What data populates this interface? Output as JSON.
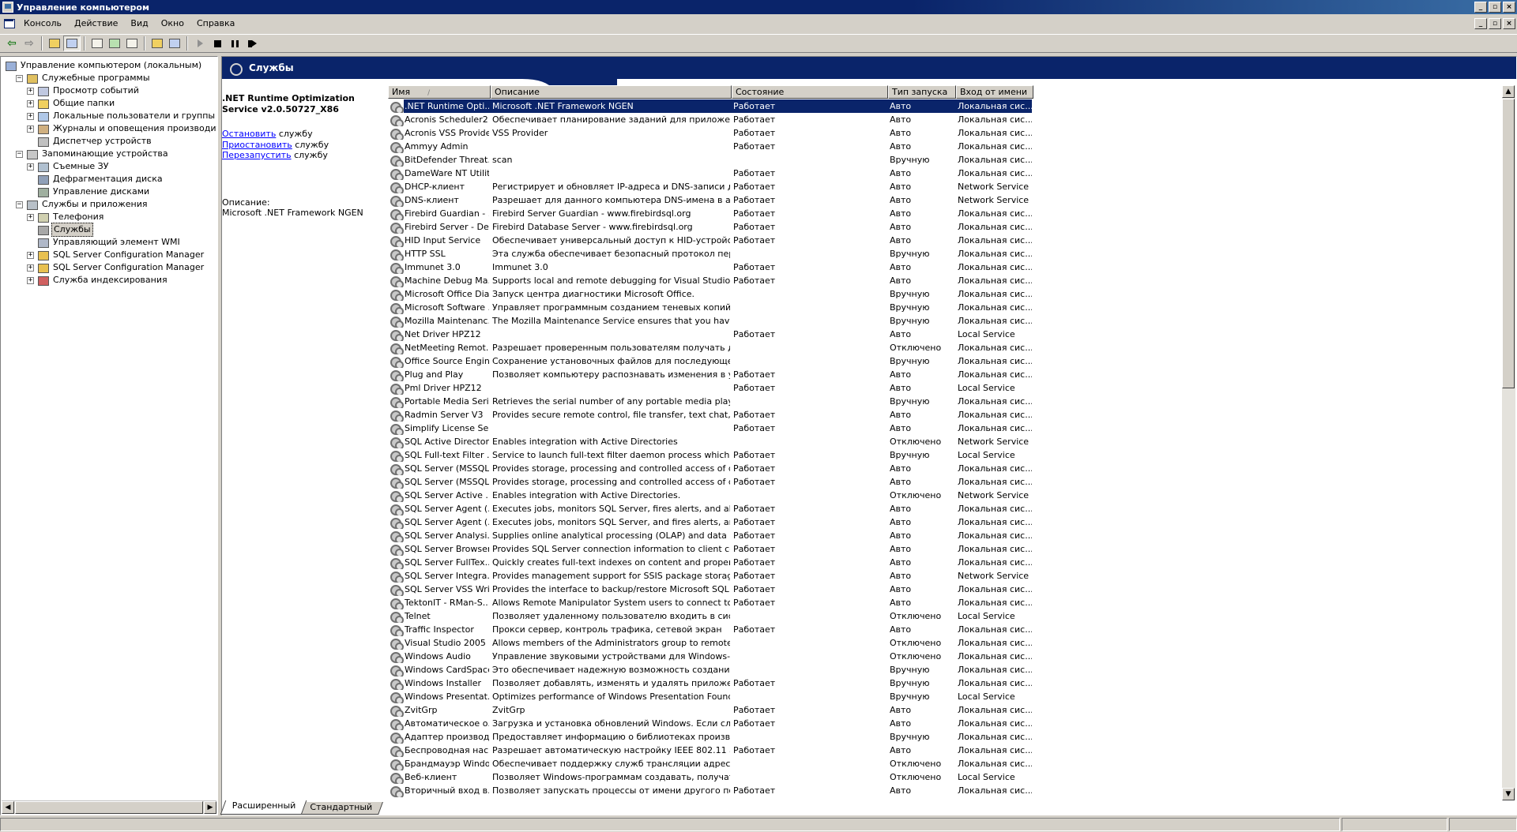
{
  "window": {
    "title": "Управление компьютером",
    "buttons": {
      "minimize": "_",
      "maximize": "▫",
      "close": "×"
    }
  },
  "menu": [
    "Консоль",
    "Действие",
    "Вид",
    "Окно",
    "Справка"
  ],
  "tree": {
    "nodes": [
      {
        "label": "Управление компьютером (локальным)",
        "level": 0,
        "expander": "",
        "color": "#9ab0d8"
      },
      {
        "label": "Служебные программы",
        "level": 1,
        "expander": "−",
        "color": "#e0c060"
      },
      {
        "label": "Просмотр событий",
        "level": 2,
        "expander": "+",
        "color": "#c0c8e0"
      },
      {
        "label": "Общие папки",
        "level": 2,
        "expander": "+",
        "color": "#f0d060"
      },
      {
        "label": "Локальные пользователи и группы",
        "level": 2,
        "expander": "+",
        "color": "#b0c8e8"
      },
      {
        "label": "Журналы и оповещения производительности",
        "level": 2,
        "expander": "+",
        "color": "#d0b080"
      },
      {
        "label": "Диспетчер устройств",
        "level": 2,
        "expander": "",
        "color": "#c0c0c0"
      },
      {
        "label": "Запоминающие устройства",
        "level": 1,
        "expander": "−",
        "color": "#c8c8c8"
      },
      {
        "label": "Съемные ЗУ",
        "level": 2,
        "expander": "+",
        "color": "#b0c0d0"
      },
      {
        "label": "Дефрагментация диска",
        "level": 2,
        "expander": "",
        "color": "#90a0b8"
      },
      {
        "label": "Управление дисками",
        "level": 2,
        "expander": "",
        "color": "#a0b0a0"
      },
      {
        "label": "Службы и приложения",
        "level": 1,
        "expander": "−",
        "color": "#b8c0c8"
      },
      {
        "label": "Телефония",
        "level": 2,
        "expander": "+",
        "color": "#d0d0b0"
      },
      {
        "label": "Службы",
        "level": 2,
        "expander": "",
        "color": "#a8a8a8",
        "selected": true
      },
      {
        "label": "Управляющий элемент WMI",
        "level": 2,
        "expander": "",
        "color": "#b0b8c8"
      },
      {
        "label": "SQL Server Configuration Manager",
        "level": 2,
        "expander": "+",
        "color": "#e8c050"
      },
      {
        "label": "SQL Server Configuration Manager",
        "level": 2,
        "expander": "+",
        "color": "#e8c050"
      },
      {
        "label": "Служба индексирования",
        "level": 2,
        "expander": "+",
        "color": "#d06060"
      }
    ]
  },
  "banner": {
    "title": "Службы"
  },
  "details": {
    "service_title": ".NET Runtime Optimization Service v2.0.50727_X86",
    "actions": [
      {
        "link": "Остановить",
        "suffix": "службу"
      },
      {
        "link": "Приостановить",
        "suffix": "службу"
      },
      {
        "link": "Перезапустить",
        "suffix": "службу"
      }
    ],
    "description_label": "Описание:",
    "description": "Microsoft .NET Framework NGEN"
  },
  "columns": {
    "name": "Имя",
    "sort_indicator": "/",
    "desc": "Описание",
    "status": "Состояние",
    "start": "Тип запуска",
    "logon": "Вход от имени"
  },
  "services": [
    {
      "name": ".NET Runtime Opti...",
      "desc": "Microsoft .NET Framework NGEN",
      "status": "Работает",
      "start": "Авто",
      "logon": "Локальная сис...",
      "selected": true
    },
    {
      "name": "Acronis Scheduler2 ...",
      "desc": "Обеспечивает планирование заданий для приложени...",
      "status": "Работает",
      "start": "Авто",
      "logon": "Локальная сис..."
    },
    {
      "name": "Acronis VSS Provider",
      "desc": "VSS Provider",
      "status": "Работает",
      "start": "Авто",
      "logon": "Локальная сис..."
    },
    {
      "name": "Ammyy Admin",
      "desc": "",
      "status": "Работает",
      "start": "Авто",
      "logon": "Локальная сис..."
    },
    {
      "name": "BitDefender Threat...",
      "desc": "scan",
      "status": "",
      "start": "Вручную",
      "logon": "Локальная сис..."
    },
    {
      "name": "DameWare NT Utilit...",
      "desc": "",
      "status": "Работает",
      "start": "Авто",
      "logon": "Локальная сис..."
    },
    {
      "name": "DHCP-клиент",
      "desc": "Регистрирует и обновляет IP-адреса и DNS-записи дл...",
      "status": "Работает",
      "start": "Авто",
      "logon": "Network Service"
    },
    {
      "name": "DNS-клиент",
      "desc": "Разрешает для данного компьютера DNS-имена в адр...",
      "status": "Работает",
      "start": "Авто",
      "logon": "Network Service"
    },
    {
      "name": "Firebird Guardian - ...",
      "desc": "Firebird Server Guardian - www.firebirdsql.org",
      "status": "Работает",
      "start": "Авто",
      "logon": "Локальная сис..."
    },
    {
      "name": "Firebird Server - De...",
      "desc": "Firebird Database Server - www.firebirdsql.org",
      "status": "Работает",
      "start": "Авто",
      "logon": "Локальная сис..."
    },
    {
      "name": "HID Input Service",
      "desc": "Обеспечивает универсальный доступ к HID-устройст...",
      "status": "Работает",
      "start": "Авто",
      "logon": "Локальная сис..."
    },
    {
      "name": "HTTP SSL",
      "desc": "Эта служба обеспечивает безопасный протокол пере...",
      "status": "",
      "start": "Вручную",
      "logon": "Локальная сис..."
    },
    {
      "name": "Immunet 3.0",
      "desc": "Immunet 3.0",
      "status": "Работает",
      "start": "Авто",
      "logon": "Локальная сис..."
    },
    {
      "name": "Machine Debug Ma...",
      "desc": "Supports local and remote debugging for Visual Studio an...",
      "status": "Работает",
      "start": "Авто",
      "logon": "Локальная сис..."
    },
    {
      "name": "Microsoft Office Dia...",
      "desc": "Запуск центра диагностики Microsoft Office.",
      "status": "",
      "start": "Вручную",
      "logon": "Локальная сис..."
    },
    {
      "name": "Microsoft Software ...",
      "desc": "Управляет программным созданием теневых копий сл...",
      "status": "",
      "start": "Вручную",
      "logon": "Локальная сис..."
    },
    {
      "name": "Mozilla Maintenanc...",
      "desc": "The Mozilla Maintenance Service ensures that you have t...",
      "status": "",
      "start": "Вручную",
      "logon": "Локальная сис..."
    },
    {
      "name": "Net Driver HPZ12",
      "desc": "",
      "status": "Работает",
      "start": "Авто",
      "logon": "Local Service"
    },
    {
      "name": "NetMeeting Remot...",
      "desc": "Разрешает проверенным пользователям получать дос...",
      "status": "",
      "start": "Отключено",
      "logon": "Локальная сис..."
    },
    {
      "name": "Office Source Engine",
      "desc": "Сохранение установочных файлов для последующег...",
      "status": "",
      "start": "Вручную",
      "logon": "Локальная сис..."
    },
    {
      "name": "Plug and Play",
      "desc": "Позволяет компьютеру распознавать изменения в уст...",
      "status": "Работает",
      "start": "Авто",
      "logon": "Локальная сис..."
    },
    {
      "name": "Pml Driver HPZ12",
      "desc": "",
      "status": "Работает",
      "start": "Авто",
      "logon": "Local Service"
    },
    {
      "name": "Portable Media Seri...",
      "desc": "Retrieves the serial number of any portable media player ...",
      "status": "",
      "start": "Вручную",
      "logon": "Локальная сис..."
    },
    {
      "name": "Radmin Server V3",
      "desc": "Provides secure remote control, file transfer, text chat, v...",
      "status": "Работает",
      "start": "Авто",
      "logon": "Локальная сис..."
    },
    {
      "name": "Simplify License Ser...",
      "desc": "",
      "status": "Работает",
      "start": "Авто",
      "logon": "Локальная сис..."
    },
    {
      "name": "SQL Active Director...",
      "desc": "Enables integration with Active Directories",
      "status": "",
      "start": "Отключено",
      "logon": "Network Service"
    },
    {
      "name": "SQL Full-text Filter ...",
      "desc": "Service to launch full-text filter daemon process which will...",
      "status": "Работает",
      "start": "Вручную",
      "logon": "Local Service"
    },
    {
      "name": "SQL Server (MSSQL...",
      "desc": "Provides storage, processing and controlled access of dat...",
      "status": "Работает",
      "start": "Авто",
      "logon": "Локальная сис..."
    },
    {
      "name": "SQL Server (MSSQL...",
      "desc": "Provides storage, processing and controlled access of dat...",
      "status": "Работает",
      "start": "Авто",
      "logon": "Локальная сис..."
    },
    {
      "name": "SQL Server Active ...",
      "desc": "Enables integration with Active Directories.",
      "status": "",
      "start": "Отключено",
      "logon": "Network Service"
    },
    {
      "name": "SQL Server Agent (...",
      "desc": "Executes jobs, monitors SQL Server, fires alerts, and allo...",
      "status": "Работает",
      "start": "Авто",
      "logon": "Локальная сис..."
    },
    {
      "name": "SQL Server Agent (...",
      "desc": "Executes jobs, monitors SQL Server, and fires alerts, and...",
      "status": "Работает",
      "start": "Авто",
      "logon": "Локальная сис..."
    },
    {
      "name": "SQL Server Analysi...",
      "desc": "Supplies online analytical processing (OLAP) and data mini...",
      "status": "Работает",
      "start": "Авто",
      "logon": "Локальная сис..."
    },
    {
      "name": "SQL Server Browser",
      "desc": "Provides SQL Server connection information to client com...",
      "status": "Работает",
      "start": "Авто",
      "logon": "Локальная сис..."
    },
    {
      "name": "SQL Server FullTex...",
      "desc": "Quickly creates full-text indexes on content and propertie...",
      "status": "Работает",
      "start": "Авто",
      "logon": "Локальная сис..."
    },
    {
      "name": "SQL Server Integra...",
      "desc": "Provides management support for SSIS package storage ...",
      "status": "Работает",
      "start": "Авто",
      "logon": "Network Service"
    },
    {
      "name": "SQL Server VSS Wri...",
      "desc": "Provides the interface to backup/restore Microsoft SQL se...",
      "status": "Работает",
      "start": "Авто",
      "logon": "Локальная сис..."
    },
    {
      "name": "TektonIT - RMan-S...",
      "desc": "Allows Remote Manipulator System users to connect to thi...",
      "status": "Работает",
      "start": "Авто",
      "logon": "Локальная сис..."
    },
    {
      "name": "Telnet",
      "desc": "Позволяет удаленному пользователю входить в сист...",
      "status": "",
      "start": "Отключено",
      "logon": "Local Service"
    },
    {
      "name": "Traffic Inspector",
      "desc": "Прокси сервер, контроль трафика, сетевой экран",
      "status": "Работает",
      "start": "Авто",
      "logon": "Локальная сис..."
    },
    {
      "name": "Visual Studio 2005 ...",
      "desc": "Allows members of the Administrators group to remotely d...",
      "status": "",
      "start": "Отключено",
      "logon": "Локальная сис..."
    },
    {
      "name": "Windows Audio",
      "desc": "Управление звуковыми устройствами для Windows-пр...",
      "status": "",
      "start": "Отключено",
      "logon": "Локальная сис..."
    },
    {
      "name": "Windows CardSpace",
      "desc": "Это обеспечивает надежную возможность создания, ...",
      "status": "",
      "start": "Вручную",
      "logon": "Локальная сис..."
    },
    {
      "name": "Windows Installer",
      "desc": "Позволяет добавлять, изменять и удалять приложен...",
      "status": "Работает",
      "start": "Вручную",
      "logon": "Локальная сис..."
    },
    {
      "name": "Windows Presentat...",
      "desc": "Optimizes performance of Windows Presentation Foundati...",
      "status": "",
      "start": "Вручную",
      "logon": "Local Service"
    },
    {
      "name": "ZvitGrp",
      "desc": "ZvitGrp",
      "status": "Работает",
      "start": "Авто",
      "logon": "Локальная сис..."
    },
    {
      "name": "Автоматическое о...",
      "desc": "Загрузка и установка обновлений Windows. Если служ...",
      "status": "Работает",
      "start": "Авто",
      "logon": "Локальная сис..."
    },
    {
      "name": "Адаптер производ...",
      "desc": "Предоставляет информацию о библиотеках производ...",
      "status": "",
      "start": "Вручную",
      "logon": "Локальная сис..."
    },
    {
      "name": "Беспроводная нас...",
      "desc": "Разрешает автоматическую настройку IEEE 802.11 ад...",
      "status": "Работает",
      "start": "Авто",
      "logon": "Локальная сис..."
    },
    {
      "name": "Брандмауэр Windo...",
      "desc": "Обеспечивает поддержку служб трансляции адресов...",
      "status": "",
      "start": "Отключено",
      "logon": "Локальная сис..."
    },
    {
      "name": "Веб-клиент",
      "desc": "Позволяет Windows-программам создавать, получать ...",
      "status": "",
      "start": "Отключено",
      "logon": "Local Service"
    },
    {
      "name": "Вторичный вход в...",
      "desc": "Позволяет запускать процессы от имени другого пол...",
      "status": "Работает",
      "start": "Авто",
      "logon": "Локальная сис..."
    }
  ],
  "tabs": [
    "Расширенный",
    "Стандартный"
  ]
}
